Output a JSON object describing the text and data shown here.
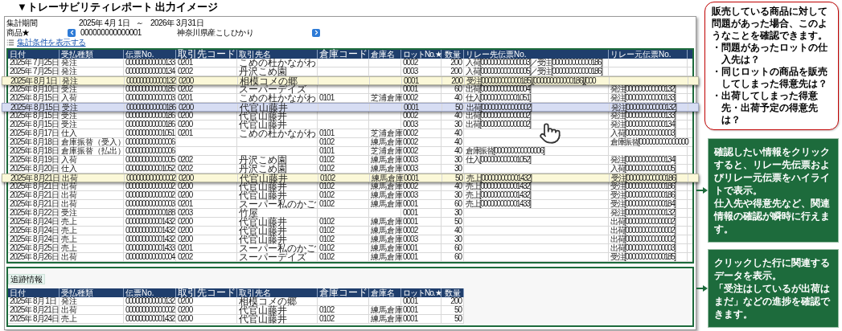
{
  "title": "▼トレーサビリティレポート 出力イメージ",
  "period": {
    "label": "集計期間",
    "from": "2025年 4月 1日",
    "separator": "～",
    "to": "2026年 3月31日"
  },
  "product": {
    "label": "商品★",
    "code": "000000000000001",
    "name": "神奈川県産こしひかり"
  },
  "conditions_link": "集計条件を表示する",
  "main_table": {
    "columns": [
      "日付",
      "受払種類",
      "伝票No.",
      "取引先コード",
      "取引先名",
      "倉庫コード",
      "倉庫名",
      "ロットNo.★",
      "数量",
      "リレー先伝票No.",
      "リレー元伝票No."
    ],
    "rows": [
      {
        "kind": "row",
        "cells": [
          "2025年 7月25日",
          "発注",
          "000000000000133",
          "0201",
          "こめの杜かながわ",
          null,
          null,
          "0002",
          "200",
          "入荷[000000000000003]／受注[000000000000186]",
          null
        ]
      },
      {
        "kind": "row",
        "cells": [
          "2025年 7月25日",
          "発注",
          "000000000000134",
          "0202",
          "丹沢こめ園",
          null,
          null,
          "0003",
          "200",
          "入荷[000000000000005]／受注[000000000000186]",
          null
        ]
      },
      {
        "kind": "related",
        "cells": [
          "2025年 8月 1日",
          "発注",
          "000000000000132",
          "0200",
          "相模コメの郷",
          null,
          null,
          "0001",
          "200",
          "受注[000000000000185],[000000000000186],[000",
          null
        ]
      },
      {
        "kind": "row",
        "cells": [
          "2025年 8月10日",
          "受注",
          "000000000000185",
          "0202",
          "スーパーデイズ",
          null,
          null,
          "0001",
          "60",
          "出荷[000000000000004]",
          "発注[000000000000132]"
        ]
      },
      {
        "kind": "row",
        "cells": [
          "2025年 8月15日",
          "入荷",
          "000000000000003",
          "0201",
          "こめの杜かながわ",
          "0101",
          "芝浦倉庫",
          "0002",
          "40",
          "仕入[000000000001051]",
          "発注[000000000000133]"
        ]
      },
      {
        "kind": "selected",
        "cells": [
          "2025年 8月15日",
          "受注",
          "000000000000186",
          "0200",
          "代官山藤井",
          null,
          null,
          "0001",
          "50",
          "出荷[000000000000002]",
          "発注[000000000000132]"
        ]
      },
      {
        "kind": "row",
        "cells": [
          "2025年 8月15日",
          "受注",
          "000000000000186",
          "0200",
          "代官山藤井",
          null,
          null,
          "0002",
          "40",
          "出荷[000000000000002]",
          "発注[000000000000133]"
        ]
      },
      {
        "kind": "row",
        "cells": [
          "2025年 8月15日",
          "受注",
          "000000000000186",
          "0200",
          "代官山藤井",
          null,
          null,
          "0003",
          "30",
          "出荷[000000000000002]",
          "発注[000000000000134]"
        ]
      },
      {
        "kind": "row",
        "cells": [
          "2025年 8月17日",
          "仕入",
          "000000000001051",
          "0201",
          "こめの杜かながわ",
          "0101",
          "芝浦倉庫",
          "0002",
          "40",
          null,
          "入荷[000000000000003]"
        ]
      },
      {
        "kind": "row",
        "cells": [
          "2025年 8月18日",
          "倉庫振替（受入）",
          "000000000000006",
          null,
          null,
          "0102",
          "練馬倉庫",
          "0002",
          "40",
          null,
          "倉庫振替[000000000000000"
        ]
      },
      {
        "kind": "row",
        "cells": [
          "2025年 8月18日",
          "倉庫振替（払出）",
          "000000000000006",
          null,
          null,
          "0101",
          "芝浦倉庫",
          "0002",
          "40",
          "倉庫振替[000000000000006]",
          null
        ]
      },
      {
        "kind": "row",
        "cells": [
          "2025年 8月19日",
          "入荷",
          "000000000000005",
          "0202",
          "丹沢こめ園",
          "0102",
          "練馬倉庫",
          "0003",
          "30",
          "仕入[000000000001052]",
          "発注[000000000000134]"
        ]
      },
      {
        "kind": "row",
        "cells": [
          "2025年 8月20日",
          "仕入",
          "000000000001052",
          "0202",
          "丹沢こめ園",
          "0102",
          "練馬倉庫",
          "0003",
          "30",
          null,
          "入荷[000000000000005]"
        ]
      },
      {
        "kind": "related",
        "cells": [
          "2025年 8月21日",
          "出荷",
          "000000000000002",
          "0200",
          "代官山藤井",
          "0102",
          "練馬倉庫",
          "0001",
          "50",
          "売上[000000000001432]",
          "受注[000000000000186]"
        ]
      },
      {
        "kind": "row",
        "cells": [
          "2025年 8月21日",
          "出荷",
          "000000000000002",
          "0200",
          "代官山藤井",
          "0102",
          "練馬倉庫",
          "0002",
          "40",
          "売上[000000000001432]",
          "受注[000000000000186]"
        ]
      },
      {
        "kind": "row",
        "cells": [
          "2025年 8月21日",
          "出荷",
          "000000000000002",
          "0200",
          "代官山藤井",
          "0102",
          "練馬倉庫",
          "0003",
          "30",
          "売上[000000000001432]",
          "受注[000000000000186]"
        ]
      },
      {
        "kind": "row",
        "cells": [
          "2025年 8月21日",
          "出荷",
          "000000000000003",
          "0201",
          "スーパー私のかご",
          "0102",
          "練馬倉庫",
          "0001",
          "60",
          "売上[000000000001433]",
          "受注[000000000000184]"
        ]
      },
      {
        "kind": "row",
        "cells": [
          "2025年 8月22日",
          "受注",
          "000000000000188",
          "0203",
          "竹屋",
          null,
          null,
          "0001",
          "30",
          null,
          "発注[000000000000132]"
        ]
      },
      {
        "kind": "row",
        "cells": [
          "2025年 8月24日",
          "売上",
          "000000000001432",
          "0200",
          "代官山藤井",
          "0102",
          "練馬倉庫",
          "0001",
          "50",
          null,
          "出荷[000000000000002]"
        ]
      },
      {
        "kind": "row",
        "cells": [
          "2025年 8月24日",
          "売上",
          "000000000001432",
          "0200",
          "代官山藤井",
          "0102",
          "練馬倉庫",
          "0002",
          "40",
          null,
          "出荷[000000000000002]"
        ]
      },
      {
        "kind": "row",
        "cells": [
          "2025年 8月24日",
          "売上",
          "000000000001432",
          "0200",
          "代官山藤井",
          "0102",
          "練馬倉庫",
          "0003",
          "30",
          null,
          "出荷[000000000000002]"
        ]
      },
      {
        "kind": "row",
        "cells": [
          "2025年 8月25日",
          "売上",
          "000000000001433",
          "0201",
          "スーパー私のかご",
          "0102",
          "練馬倉庫",
          "0001",
          "60",
          null,
          "出荷[000000000000003]"
        ]
      },
      {
        "kind": "row",
        "cells": [
          "2025年 8月26日",
          "出荷",
          "000000000000004",
          "0202",
          "スーパーデイズ",
          "0102",
          "練馬倉庫",
          "0001",
          "60",
          null,
          "受注[000000000000185]"
        ]
      }
    ]
  },
  "progress_panel": {
    "tab": "追跡情報",
    "columns": [
      "日付",
      "受払種類",
      "伝票No.",
      "取引先コード",
      "取引先名",
      "倉庫コード",
      "倉庫名",
      "ロットNo.★",
      "数量"
    ],
    "rows": [
      [
        "2025年 8月 1日",
        "発注",
        "000000000000132",
        "0200",
        "相模コメの郷",
        null,
        null,
        "0001",
        "200"
      ],
      [
        "2025年 8月21日",
        "出荷",
        "000000000000002",
        "0200",
        "代官山藤井",
        "0102",
        "練馬倉庫",
        "0001",
        "50"
      ],
      [
        "2025年 8月24日",
        "売上",
        "000000000001432",
        "0200",
        "代官山藤井",
        "0102",
        "練馬倉庫",
        "0001",
        "50"
      ]
    ]
  },
  "question_callout": {
    "heading": "販売している商品に対して問題があった場合、このようなことを確認できます。",
    "items": [
      {
        "bullet": "・",
        "text": "問題があったロットの仕入先は？"
      },
      {
        "bullet": "・",
        "text": "同じロットの商品を販売してしまった得意先は？"
      },
      {
        "bullet": "・",
        "text": "出荷してしまった得意先・出荷予定の得意先は？"
      }
    ]
  },
  "notes": [
    {
      "paragraphs": [
        "確認したい情報をクリックすると、リレー先伝票およびリレー元伝票をハイライトで表示。",
        "仕入先や得意先など、関連情報の確認が瞬時に行えます。"
      ]
    },
    {
      "paragraphs": [
        "クリックした行に関連するデータを表示。",
        "「受注はしているが出荷はまだ」などの進捗を確認できます。"
      ]
    }
  ]
}
